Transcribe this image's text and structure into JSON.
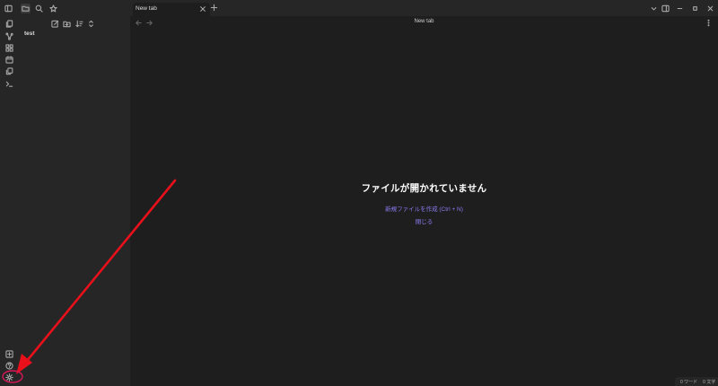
{
  "tabs": [
    {
      "label": "New tab"
    }
  ],
  "view_header": {
    "title": "New tab"
  },
  "sidebar": {
    "files": [
      {
        "name": "test"
      }
    ]
  },
  "empty_state": {
    "title": "ファイルが開かれていません",
    "create_link": "新規ファイルを作成 (Ctrl + N)",
    "close_link": "閉じる"
  },
  "statusbar": {
    "words": "0 ワード",
    "chars": "0 文字"
  },
  "colors": {
    "link": "#8a7cf0",
    "annotation": "#e8101a",
    "background": "#1e1e1e",
    "panel": "#262626"
  }
}
